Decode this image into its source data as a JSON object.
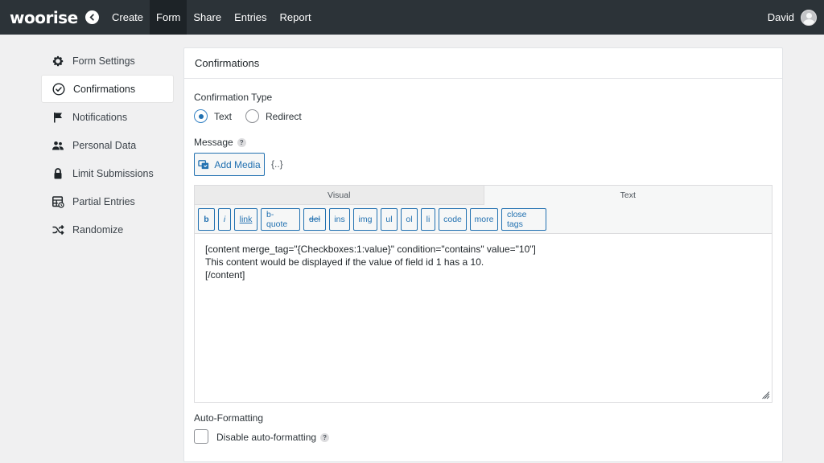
{
  "topbar": {
    "logo": "woorise",
    "nav": [
      {
        "label": "Create"
      },
      {
        "label": "Form",
        "active": true
      },
      {
        "label": "Share"
      },
      {
        "label": "Entries"
      },
      {
        "label": "Report"
      }
    ],
    "user_name": "David"
  },
  "sidebar": {
    "items": [
      {
        "label": "Form Settings",
        "icon": "gear-icon"
      },
      {
        "label": "Confirmations",
        "icon": "check-circle-icon",
        "active": true
      },
      {
        "label": "Notifications",
        "icon": "flag-icon"
      },
      {
        "label": "Personal Data",
        "icon": "users-icon"
      },
      {
        "label": "Limit Submissions",
        "icon": "lock-icon"
      },
      {
        "label": "Partial Entries",
        "icon": "table-icon"
      },
      {
        "label": "Randomize",
        "icon": "shuffle-icon"
      }
    ]
  },
  "panel": {
    "title": "Confirmations",
    "confirmation_type_label": "Confirmation Type",
    "radio_text": "Text",
    "radio_redirect": "Redirect",
    "selected_type": "Text",
    "message_label": "Message",
    "help_glyph": "?",
    "add_media_label": "Add Media",
    "merge_tags_label": "{..}",
    "editor": {
      "tab_visual": "Visual",
      "tab_text": "Text",
      "active_tab": "Text",
      "toolbar": [
        "b",
        "i",
        "link",
        "b-quote",
        "del",
        "ins",
        "img",
        "ul",
        "ol",
        "li",
        "code",
        "more",
        "close tags"
      ],
      "content_lines": [
        "[content merge_tag=\"{Checkboxes:1:value}\" condition=\"contains\" value=\"10\"]",
        "This content would be displayed if the value of field id 1 has a 10.",
        "[/content]"
      ]
    },
    "auto_formatting_label": "Auto-Formatting",
    "disable_auto_formatting_label": "Disable auto-formatting",
    "disable_auto_formatting_checked": false
  },
  "colors": {
    "topbar_bg": "#2c3338",
    "accent": "#2271b1",
    "page_bg": "#f0f0f1"
  }
}
